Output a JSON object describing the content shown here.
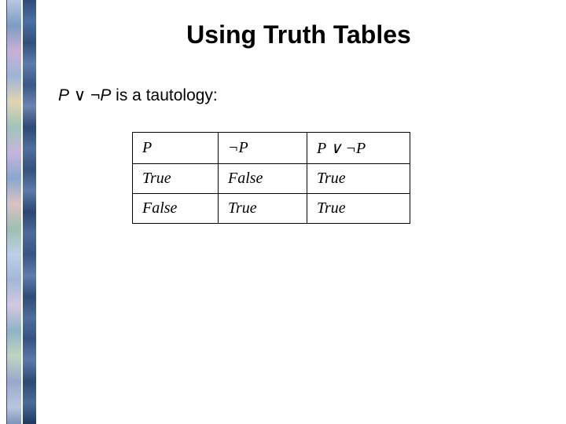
{
  "title": "Using Truth Tables",
  "statement": {
    "P1": "P",
    "or": " ∨ ",
    "neg": "¬",
    "P2": "P",
    "rest": " is a tautology:"
  },
  "table": {
    "headers": {
      "c1": "P",
      "c2": "¬P",
      "c3": "P ∨ ¬P"
    },
    "rows": [
      {
        "c1": "True",
        "c2": "False",
        "c3": "True"
      },
      {
        "c1": "False",
        "c2": "True",
        "c3": "True"
      }
    ]
  },
  "chart_data": {
    "type": "table",
    "title": "Truth table for P ∨ ¬P",
    "columns": [
      "P",
      "¬P",
      "P ∨ ¬P"
    ],
    "rows": [
      [
        "True",
        "False",
        "True"
      ],
      [
        "False",
        "True",
        "True"
      ]
    ]
  }
}
